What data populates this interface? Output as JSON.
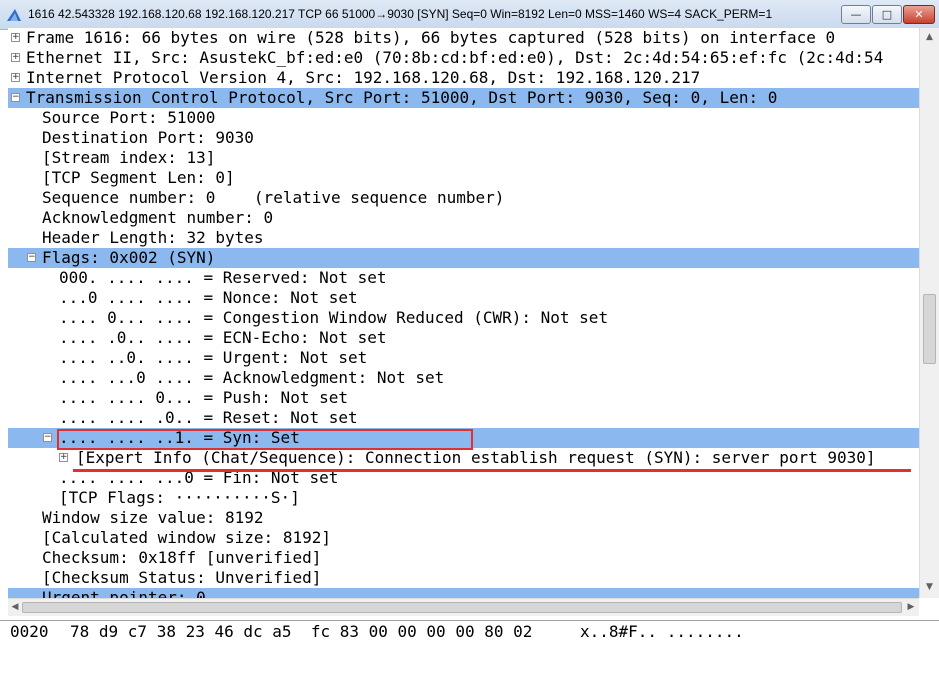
{
  "window": {
    "title": "1616 42.543328 192.168.120.68 192.168.120.217 TCP 66 51000→9030 [SYN] Seq=0 Win=8192 Len=0 MSS=1460 WS=4 SACK_PERM=1",
    "btn_min": "—",
    "btn_max": "□",
    "btn_close": "✕"
  },
  "tree": [
    {
      "name": "tree-frame",
      "indent": 0,
      "expander": "+",
      "text": "Frame 1616: 66 bytes on wire (528 bits), 66 bytes captured (528 bits) on interface 0",
      "sel": false
    },
    {
      "name": "tree-ethernet",
      "indent": 0,
      "expander": "+",
      "text": "Ethernet II, Src: AsustekC_bf:ed:e0 (70:8b:cd:bf:ed:e0), Dst: 2c:4d:54:65:ef:fc (2c:4d:54",
      "sel": false
    },
    {
      "name": "tree-ipv4",
      "indent": 0,
      "expander": "+",
      "text": "Internet Protocol Version 4, Src: 192.168.120.68, Dst: 192.168.120.217",
      "sel": false
    },
    {
      "name": "tree-tcp",
      "indent": 0,
      "expander": "−",
      "text": "Transmission Control Protocol, Src Port: 51000, Dst Port: 9030, Seq: 0, Len: 0",
      "sel": true
    },
    {
      "name": "tree-src-port",
      "indent": 1,
      "expander": "",
      "text": "Source Port: 51000",
      "sel": false
    },
    {
      "name": "tree-dst-port",
      "indent": 1,
      "expander": "",
      "text": "Destination Port: 9030",
      "sel": false
    },
    {
      "name": "tree-stream-index",
      "indent": 1,
      "expander": "",
      "text": "[Stream index: 13]",
      "sel": false
    },
    {
      "name": "tree-seg-len",
      "indent": 1,
      "expander": "",
      "text": "[TCP Segment Len: 0]",
      "sel": false
    },
    {
      "name": "tree-seq",
      "indent": 1,
      "expander": "",
      "text": "Sequence number: 0    (relative sequence number)",
      "sel": false
    },
    {
      "name": "tree-ack",
      "indent": 1,
      "expander": "",
      "text": "Acknowledgment number: 0",
      "sel": false
    },
    {
      "name": "tree-hdr-len",
      "indent": 1,
      "expander": "",
      "text": "Header Length: 32 bytes",
      "sel": false
    },
    {
      "name": "tree-flags",
      "indent": 1,
      "expander": "−",
      "text": "Flags: 0x002 (SYN)",
      "sel": true
    },
    {
      "name": "tree-flag-reserved",
      "indent": 2,
      "expander": "",
      "text": "000. .... .... = Reserved: Not set",
      "sel": false
    },
    {
      "name": "tree-flag-nonce",
      "indent": 2,
      "expander": "",
      "text": "...0 .... .... = Nonce: Not set",
      "sel": false
    },
    {
      "name": "tree-flag-cwr",
      "indent": 2,
      "expander": "",
      "text": ".... 0... .... = Congestion Window Reduced (CWR): Not set",
      "sel": false
    },
    {
      "name": "tree-flag-ecn",
      "indent": 2,
      "expander": "",
      "text": ".... .0.. .... = ECN-Echo: Not set",
      "sel": false
    },
    {
      "name": "tree-flag-urg",
      "indent": 2,
      "expander": "",
      "text": ".... ..0. .... = Urgent: Not set",
      "sel": false
    },
    {
      "name": "tree-flag-ack",
      "indent": 2,
      "expander": "",
      "text": ".... ...0 .... = Acknowledgment: Not set",
      "sel": false
    },
    {
      "name": "tree-flag-push",
      "indent": 2,
      "expander": "",
      "text": ".... .... 0... = Push: Not set",
      "sel": false
    },
    {
      "name": "tree-flag-reset",
      "indent": 2,
      "expander": "",
      "text": ".... .... .0.. = Reset: Not set",
      "sel": false
    },
    {
      "name": "tree-flag-syn",
      "indent": 2,
      "expander": "−",
      "text": ".... .... ..1. = Syn: Set",
      "sel": true
    },
    {
      "name": "tree-expert-info",
      "indent": 3,
      "expander": "+",
      "text": "[Expert Info (Chat/Sequence): Connection establish request (SYN): server port 9030]",
      "sel": false
    },
    {
      "name": "tree-flag-fin",
      "indent": 2,
      "expander": "",
      "text": ".... .... ...0 = Fin: Not set",
      "sel": false
    },
    {
      "name": "tree-tcp-flags",
      "indent": 2,
      "expander": "",
      "text": "[TCP Flags: ··········S·]",
      "sel": false
    },
    {
      "name": "tree-window-size",
      "indent": 1,
      "expander": "",
      "text": "Window size value: 8192",
      "sel": false
    },
    {
      "name": "tree-calc-window",
      "indent": 1,
      "expander": "",
      "text": "[Calculated window size: 8192]",
      "sel": false
    },
    {
      "name": "tree-checksum",
      "indent": 1,
      "expander": "",
      "text": "Checksum: 0x18ff [unverified]",
      "sel": false
    },
    {
      "name": "tree-checksum-status",
      "indent": 1,
      "expander": "",
      "text": "[Checksum Status: Unverified]",
      "sel": false
    },
    {
      "name": "tree-urgent-pointer",
      "indent": 1,
      "expander": "",
      "text": "Urgent pointer: 0",
      "sel": true
    }
  ],
  "hex": {
    "offset": "0020",
    "bytes": "78 d9 c7 38 23 46 dc a5  fc 83 00 00 00 00 80 02",
    "ascii": "x..8#F.. ........"
  },
  "colors": {
    "selection": "#8ab8ef",
    "highlight": "#e03030"
  }
}
